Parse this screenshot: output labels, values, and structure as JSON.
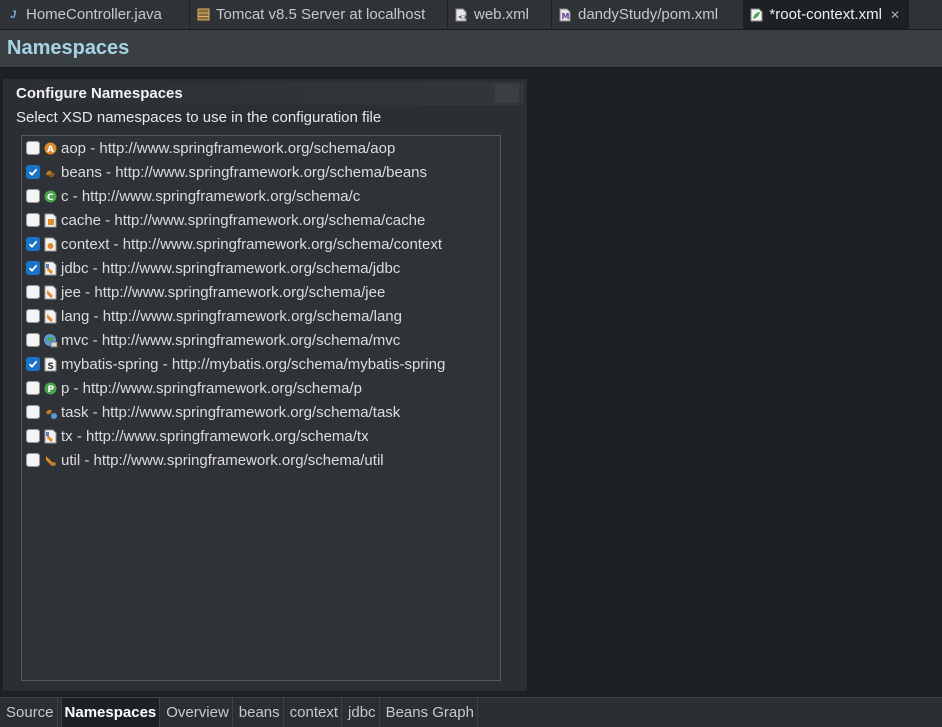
{
  "editor_tabs": [
    {
      "label": "HomeController.java",
      "icon": "java-file-icon",
      "active": false
    },
    {
      "label": "Tomcat v8.5 Server at localhost",
      "icon": "server-icon",
      "active": false
    },
    {
      "label": "web.xml",
      "icon": "xml-file-icon",
      "active": false
    },
    {
      "label": "dandyStudy/pom.xml",
      "icon": "maven-pom-icon",
      "active": false
    },
    {
      "label": "*root-context.xml",
      "icon": "spring-config-icon",
      "active": true,
      "close": "✕"
    }
  ],
  "page": {
    "title": "Namespaces"
  },
  "section": {
    "title": "Configure Namespaces",
    "description": "Select XSD namespaces to use in the configuration file"
  },
  "namespaces": [
    {
      "label": "aop - http://www.springframework.org/schema/aop",
      "checked": false,
      "icon": "aop-icon"
    },
    {
      "label": "beans - http://www.springframework.org/schema/beans",
      "checked": true,
      "icon": "beans-icon"
    },
    {
      "label": "c - http://www.springframework.org/schema/c",
      "checked": false,
      "icon": "c-namespace-icon"
    },
    {
      "label": "cache - http://www.springframework.org/schema/cache",
      "checked": false,
      "icon": "cache-icon"
    },
    {
      "label": "context - http://www.springframework.org/schema/context",
      "checked": true,
      "icon": "context-icon"
    },
    {
      "label": "jdbc - http://www.springframework.org/schema/jdbc",
      "checked": true,
      "icon": "jdbc-icon"
    },
    {
      "label": "jee - http://www.springframework.org/schema/jee",
      "checked": false,
      "icon": "jee-icon"
    },
    {
      "label": "lang - http://www.springframework.org/schema/lang",
      "checked": false,
      "icon": "lang-icon"
    },
    {
      "label": "mvc - http://www.springframework.org/schema/mvc",
      "checked": false,
      "icon": "mvc-icon"
    },
    {
      "label": "mybatis-spring - http://mybatis.org/schema/mybatis-spring",
      "checked": true,
      "icon": "mybatis-icon"
    },
    {
      "label": "p - http://www.springframework.org/schema/p",
      "checked": false,
      "icon": "p-namespace-icon"
    },
    {
      "label": "task - http://www.springframework.org/schema/task",
      "checked": false,
      "icon": "task-icon"
    },
    {
      "label": "tx - http://www.springframework.org/schema/tx",
      "checked": false,
      "icon": "tx-icon"
    },
    {
      "label": "util - http://www.springframework.org/schema/util",
      "checked": false,
      "icon": "util-icon"
    }
  ],
  "bottom_tabs": [
    {
      "label": "Source",
      "active": false
    },
    {
      "label": "Namespaces",
      "active": true
    },
    {
      "label": "Overview",
      "active": false
    },
    {
      "label": "beans",
      "active": false
    },
    {
      "label": "context",
      "active": false
    },
    {
      "label": "jdbc",
      "active": false
    },
    {
      "label": "Beans Graph",
      "active": false
    }
  ],
  "colors": {
    "background": "#1e2124",
    "header_title": "#a8d2e6",
    "checkbox_checked": "#1a73c9",
    "icon_orange": "#e08a2c",
    "icon_green": "#4ea34e"
  }
}
